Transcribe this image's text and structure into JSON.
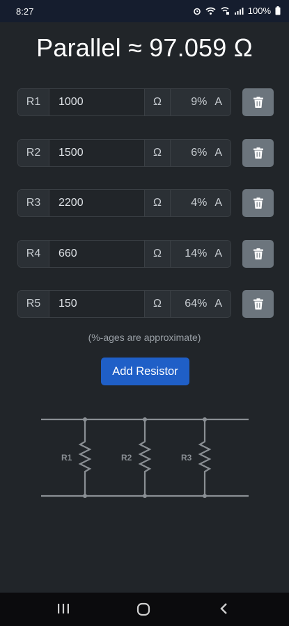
{
  "status_bar": {
    "time": "8:27",
    "battery": "100%",
    "icons": [
      "alarm-icon",
      "wifi-icon",
      "wifi-calling-icon",
      "signal-icon",
      "battery-icon"
    ]
  },
  "title": "Parallel ≈ 97.059 Ω",
  "resistors": [
    {
      "label": "R1",
      "value": "1000",
      "unit": "Ω",
      "percent": "9%",
      "current_unit": "A"
    },
    {
      "label": "R2",
      "value": "1500",
      "unit": "Ω",
      "percent": "6%",
      "current_unit": "A"
    },
    {
      "label": "R3",
      "value": "2200",
      "unit": "Ω",
      "percent": "4%",
      "current_unit": "A"
    },
    {
      "label": "R4",
      "value": "660",
      "unit": "Ω",
      "percent": "14%",
      "current_unit": "A"
    },
    {
      "label": "R5",
      "value": "150",
      "unit": "Ω",
      "percent": "64%",
      "current_unit": "A"
    }
  ],
  "note": "(%-ages are approximate)",
  "add_button_label": "Add Resistor",
  "diagram": {
    "labels": [
      "R1",
      "R2",
      "R3"
    ]
  },
  "colors": {
    "background": "#212529",
    "button_primary": "#1f5fc7",
    "button_delete": "#6c757d",
    "wire": "#8a8f94"
  }
}
